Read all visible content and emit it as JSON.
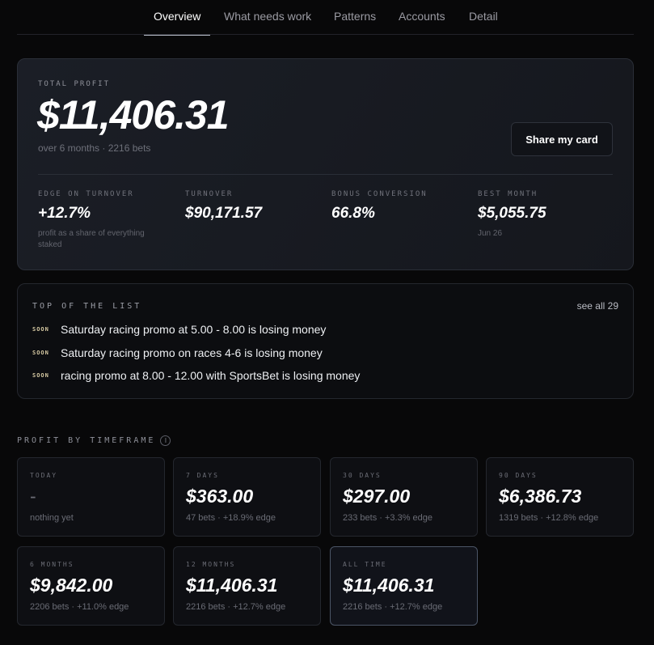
{
  "tabs": [
    {
      "label": "Overview",
      "active": true
    },
    {
      "label": "What needs work",
      "active": false
    },
    {
      "label": "Patterns",
      "active": false
    },
    {
      "label": "Accounts",
      "active": false
    },
    {
      "label": "Detail",
      "active": false
    }
  ],
  "hero": {
    "label": "TOTAL PROFIT",
    "value": "$11,406.31",
    "subtitle": "over 6 months · 2216 bets",
    "share_label": "Share my card",
    "stats": [
      {
        "label": "EDGE ON TURNOVER",
        "value": "+12.7%",
        "sub": "profit as a share of everything staked"
      },
      {
        "label": "TURNOVER",
        "value": "$90,171.57",
        "sub": ""
      },
      {
        "label": "BONUS CONVERSION",
        "value": "66.8%",
        "sub": ""
      },
      {
        "label": "BEST MONTH",
        "value": "$5,055.75",
        "sub": "Jun 26"
      }
    ]
  },
  "top_list": {
    "title": "TOP OF THE LIST",
    "see_all": "see all 29",
    "items": [
      {
        "badge": "SOON",
        "text": "Saturday racing promo at 5.00 - 8.00 is losing money"
      },
      {
        "badge": "SOON",
        "text": "Saturday racing promo on races 4-6 is losing money"
      },
      {
        "badge": "SOON",
        "text": "racing promo at 8.00 - 12.00 with SportsBet is losing money"
      }
    ]
  },
  "timeframes": {
    "title": "PROFIT BY TIMEFRAME",
    "info_icon": "i",
    "cards": [
      {
        "label": "TODAY",
        "value": "-",
        "sub": "nothing yet",
        "selected": false
      },
      {
        "label": "7 DAYS",
        "value": "$363.00",
        "sub": "47 bets · +18.9% edge",
        "selected": false
      },
      {
        "label": "30 DAYS",
        "value": "$297.00",
        "sub": "233 bets · +3.3% edge",
        "selected": false
      },
      {
        "label": "90 DAYS",
        "value": "$6,386.73",
        "sub": "1319 bets · +12.8% edge",
        "selected": false
      },
      {
        "label": "6 MONTHS",
        "value": "$9,842.00",
        "sub": "2206 bets · +11.0% edge",
        "selected": false
      },
      {
        "label": "12 MONTHS",
        "value": "$11,406.31",
        "sub": "2216 bets · +12.7% edge",
        "selected": false
      },
      {
        "label": "ALL TIME",
        "value": "$11,406.31",
        "sub": "2216 bets · +12.7% edge",
        "selected": true
      }
    ]
  }
}
